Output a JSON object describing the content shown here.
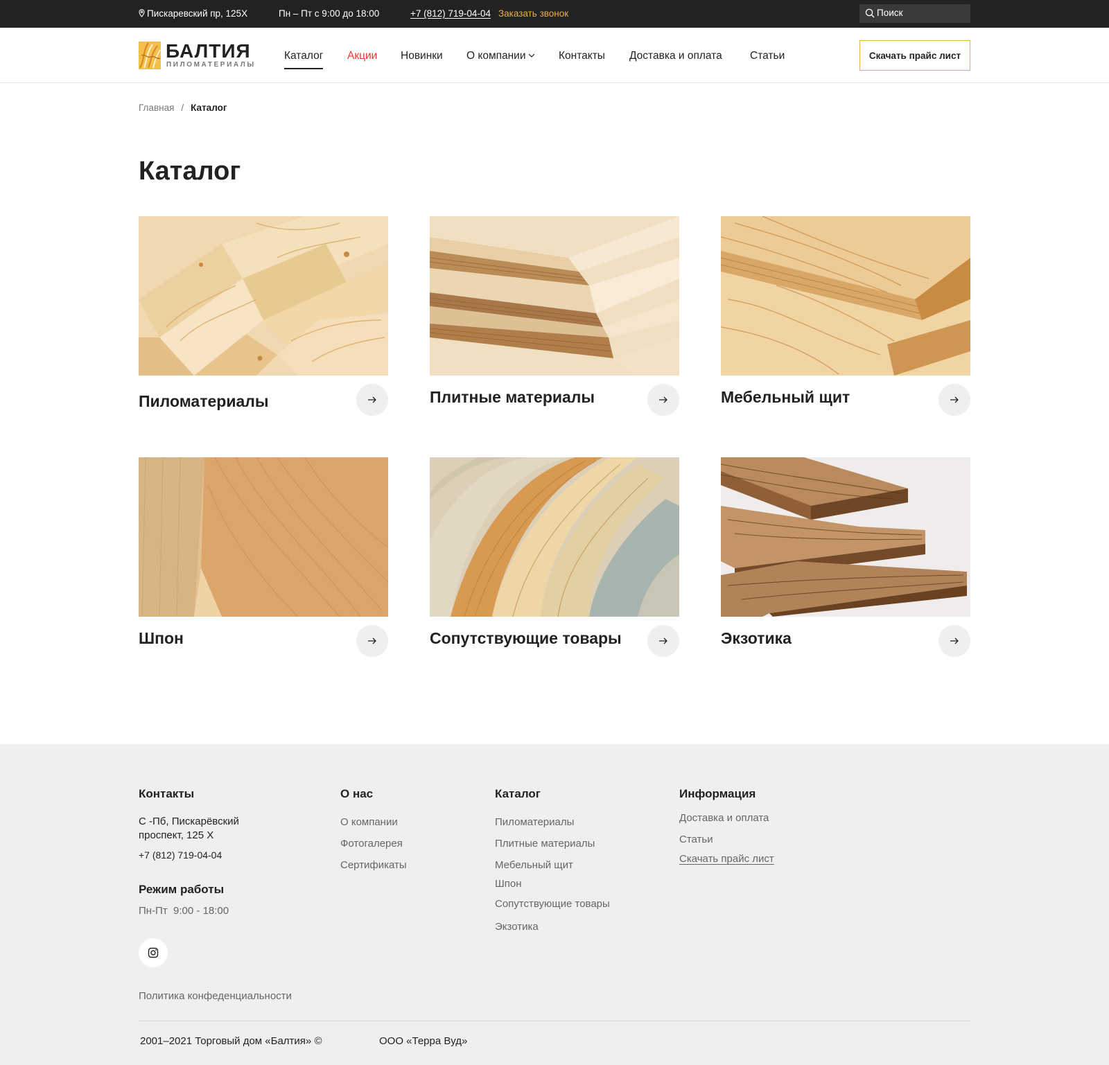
{
  "topbar": {
    "address": "Пискаревский пр, 125Х",
    "hours": "Пн – Пт с 9:00 до 18:00",
    "phone": "+7 (812) 719-04-04",
    "callback": "Заказать звонок",
    "search_placeholder": "Поиск"
  },
  "header": {
    "logo_name": "БАЛТИЯ",
    "logo_sub": "ПИЛОМАТЕРИАЛЫ",
    "nav": [
      "Каталог",
      "Акции",
      "Новинки",
      "О компании",
      "Контакты",
      "Доставка и оплата",
      "Статьи"
    ],
    "price_button": "Скачать прайс лист"
  },
  "breadcrumb": {
    "home": "Главная",
    "separator": "/",
    "current": "Каталог"
  },
  "page_title": "Каталог",
  "catalog": [
    {
      "title": "Пиломатериалы"
    },
    {
      "title": "Плитные материалы"
    },
    {
      "title": "Мебельный щит"
    },
    {
      "title": "Шпон"
    },
    {
      "title": "Сопутствующие товары"
    },
    {
      "title": "Экзотика"
    }
  ],
  "footer": {
    "contacts": {
      "heading": "Контакты",
      "address_line1": "С -Пб, Пискарёвский",
      "address_line2": "проспект, 125 Х",
      "phone": "+7 (812) 719-04-04",
      "hours_heading": "Режим работы",
      "hours": "Пн-Пт  9:00 - 18:00"
    },
    "about": {
      "heading": "О нас",
      "links": [
        "О компании",
        "Фотогалерея",
        "Сертификаты"
      ]
    },
    "catalog": {
      "heading": "Каталог",
      "links": [
        "Пиломатериалы",
        "Плитные материалы",
        "Мебельный щит",
        "Шпон",
        "Сопутствующие товары",
        "Экзотика"
      ]
    },
    "info": {
      "heading": "Информация",
      "links": [
        "Доставка и оплата",
        "Статьи",
        "Скачать прайс лист"
      ]
    },
    "privacy": "Политика конфеденциальности",
    "copyright": "2001–2021 Торговый дом «Балтия» ©",
    "company": "ООО «Терра Вуд»"
  },
  "colors": {
    "accent": "#e8b04a",
    "sale": "#e53935",
    "topbar": "#222222",
    "footer_bg": "#efefef"
  }
}
